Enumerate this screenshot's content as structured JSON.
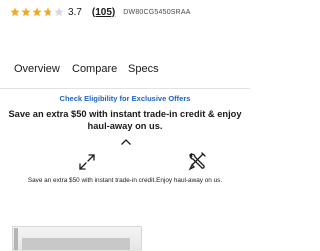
{
  "rating": {
    "value": "3.7",
    "stars_filled": 3.7,
    "stars_total": 5,
    "review_count": "(105)",
    "model_code": "DW80CG5450SRAA",
    "star_color": "#f2a81d"
  },
  "tabs": [
    {
      "label": "Overview"
    },
    {
      "label": "Compare"
    },
    {
      "label": "Specs"
    }
  ],
  "promo": {
    "eligibility_link": "Check Eligibility for Exclusive Offers",
    "heading": "Save an extra $50 with instant trade-in credit & enjoy haul-away on us.",
    "detail_part1": "Save an extra $50 with instant trade-in credit.",
    "detail_part2": "Enjoy haul-away on us.",
    "link_color": "#1f63c9"
  },
  "icons": {
    "collapse": "chevron-up-icon",
    "trade_in": "trade-in-arrows-icon",
    "haul_away": "tools-icon"
  }
}
